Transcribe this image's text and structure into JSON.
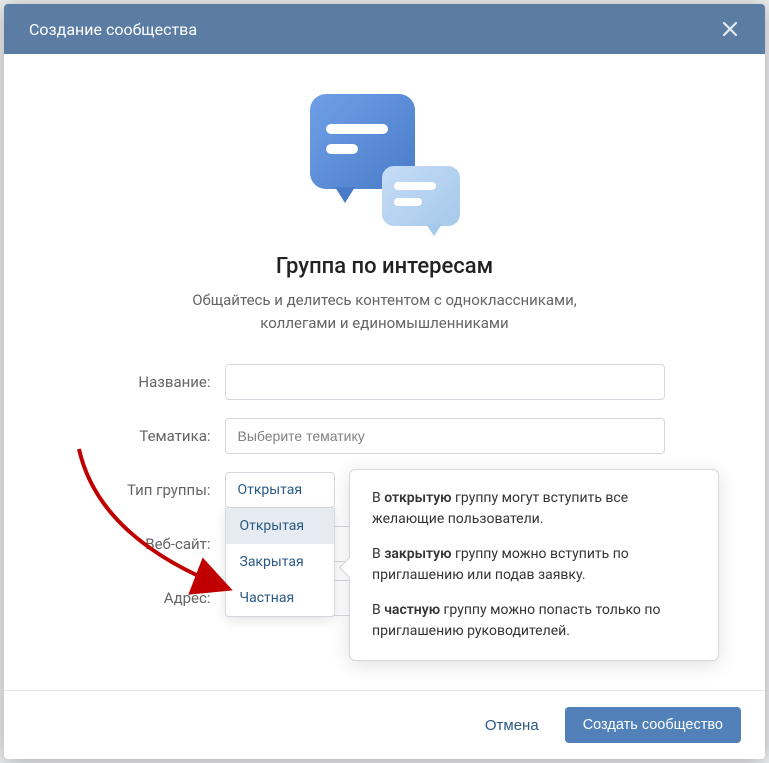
{
  "header": {
    "title": "Создание сообщества"
  },
  "hero": {
    "title": "Группа по интересам",
    "subtitle": "Общайтесь и делитесь контентом с одноклассниками, коллегами и единомышленниками"
  },
  "form": {
    "name_label": "Название:",
    "name_value": "",
    "topic_label": "Тематика:",
    "topic_placeholder": "Выберите тематику",
    "type_label": "Тип группы:",
    "type_selected": "Открытая",
    "type_options": [
      "Открытая",
      "Закрытая",
      "Частная"
    ],
    "website_label": "Веб-сайт:",
    "website_value": "",
    "address_label": "Адрес:",
    "address_value": ""
  },
  "tooltip": {
    "p1_prefix": "В ",
    "p1_bold": "открытую",
    "p1_suffix": " группу могут вступить все желающие пользователи.",
    "p2_prefix": "В ",
    "p2_bold": "закрытую",
    "p2_suffix": " группу можно вступить по приглашению или подав заявку.",
    "p3_prefix": "В ",
    "p3_bold": "частную",
    "p3_suffix": " группу можно попасть только по приглашению руководителей."
  },
  "footer": {
    "cancel": "Отмена",
    "submit": "Создать сообщество"
  }
}
